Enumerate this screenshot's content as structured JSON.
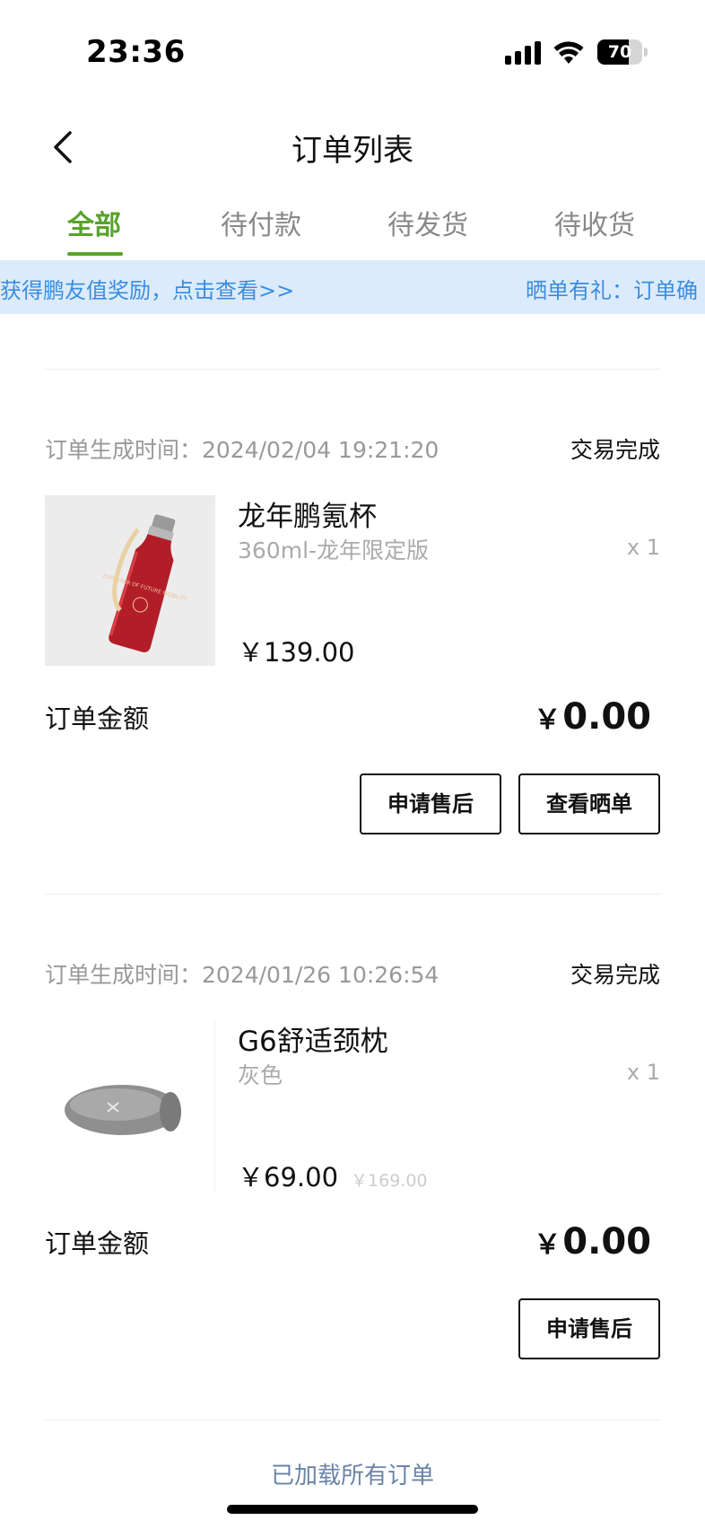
{
  "status_bar": {
    "time": "23:36",
    "battery_level": 70,
    "battery_text": "70"
  },
  "nav": {
    "title": "订单列表"
  },
  "tabs": [
    {
      "label": "全部",
      "active": true
    },
    {
      "label": "待付款",
      "active": false
    },
    {
      "label": "待发货",
      "active": false
    },
    {
      "label": "待收货",
      "active": false
    }
  ],
  "banner": {
    "text1": "获得鹏友值奖励，点击查看>>",
    "text2": "晒单有礼：订单确"
  },
  "orders": [
    {
      "time": "订单生成时间：2024/02/04 19:21:20",
      "status": "交易完成",
      "product_name": "龙年鹏氪杯",
      "spec": "360ml-龙年限定版",
      "qty": "x 1",
      "price": "￥139.00",
      "original_price": "",
      "amount_label": "订单金额",
      "amount_currency": "￥",
      "amount_value": "0.00",
      "buttons": [
        "申请售后",
        "查看晒单"
      ],
      "image_text": "EXPLORER OF FUTURE MOBILITY"
    },
    {
      "time": "订单生成时间：2024/01/26 10:26:54",
      "status": "交易完成",
      "product_name": "G6舒适颈枕",
      "spec": "灰色",
      "qty": "x 1",
      "price": "￥69.00",
      "original_price": "￥169.00",
      "amount_label": "订单金额",
      "amount_currency": "￥",
      "amount_value": "0.00",
      "buttons": [
        "申请售后"
      ]
    }
  ],
  "footer": {
    "text": "已加载所有订单"
  },
  "colors": {
    "accent": "#58a32a",
    "banner_bg": "#dcebfb",
    "banner_text": "#3a8de0",
    "footer_text": "#6a84a6"
  }
}
